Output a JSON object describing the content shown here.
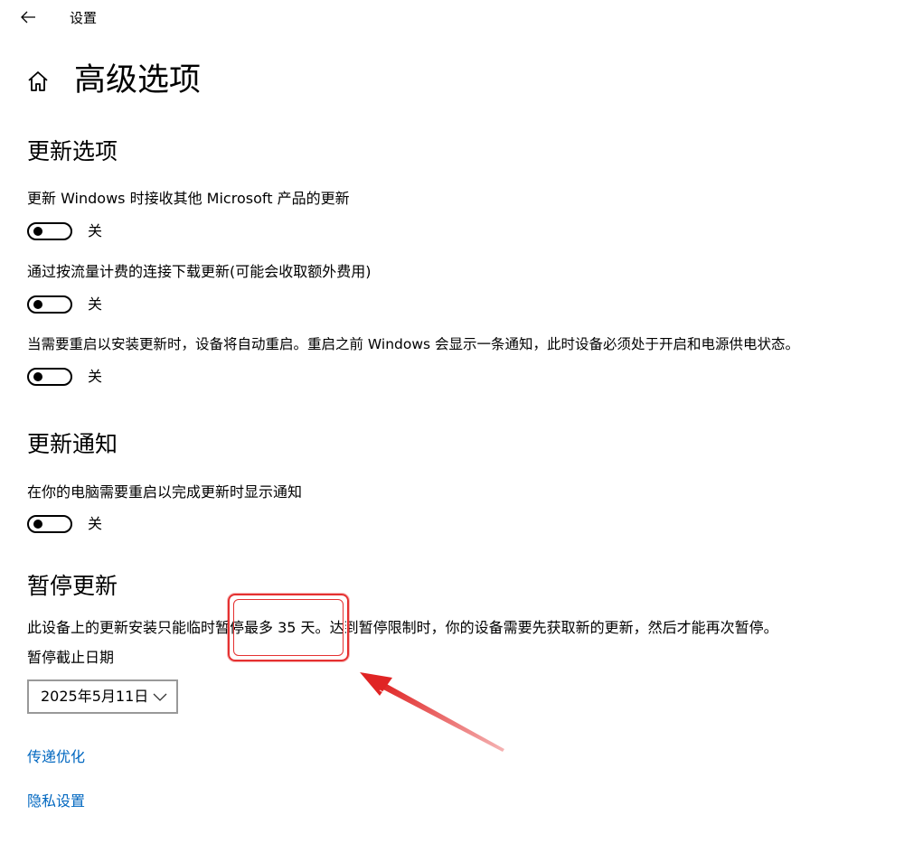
{
  "window": {
    "title": "设置",
    "back_icon": "arrow-left-icon"
  },
  "header": {
    "home_icon": "home-icon",
    "title": "高级选项"
  },
  "update_options": {
    "title": "更新选项",
    "settings": [
      {
        "label": "更新 Windows 时接收其他 Microsoft 产品的更新",
        "state": "关",
        "on": false
      },
      {
        "label": "通过按流量计费的连接下载更新(可能会收取额外费用)",
        "state": "关",
        "on": false
      },
      {
        "label": "当需要重启以安装更新时，设备将自动重启。重启之前 Windows 会显示一条通知，此时设备必须处于开启和电源供电状态。",
        "state": "关",
        "on": false
      }
    ]
  },
  "update_notifications": {
    "title": "更新通知",
    "settings": [
      {
        "label": "在你的电脑需要重启以完成更新时显示通知",
        "state": "关",
        "on": false
      }
    ]
  },
  "pause_updates": {
    "title": "暂停更新",
    "desc_before": "此设备上的更新安装只能临时",
    "desc_highlight": "暂停最多 35 天。",
    "desc_after": "达到暂停限制时，你的设备需要先获取新的更新，然后才能再次暂停。",
    "date_label": "暂停截止日期",
    "date_value": "2025年5月11日"
  },
  "links": {
    "delivery_optimization": "传递优化",
    "privacy_settings": "隐私设置"
  },
  "annotation": {
    "color": "#e53030"
  },
  "colors": {
    "link": "#0067c0",
    "dropdown_border": "#999999"
  }
}
